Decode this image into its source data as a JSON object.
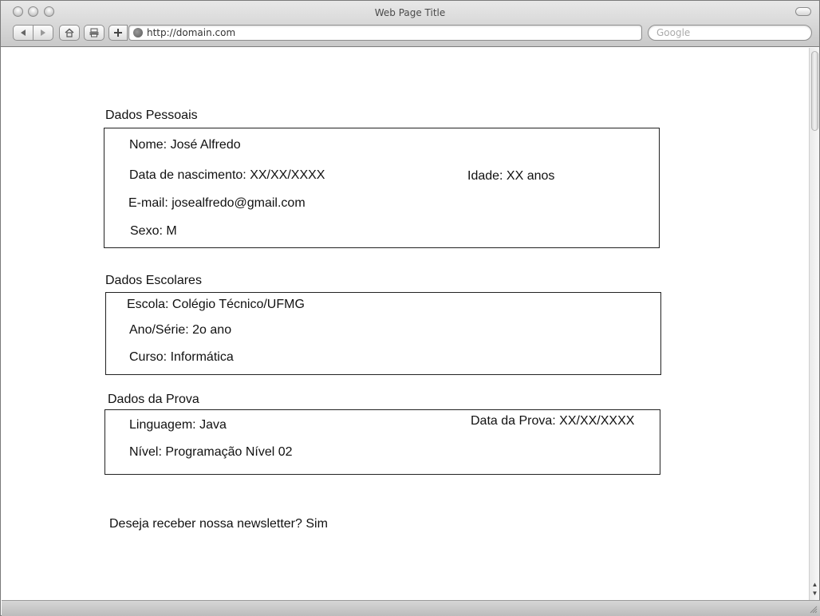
{
  "window": {
    "title": "Web Page Title",
    "url": "http://domain.com",
    "search_placeholder": "Google"
  },
  "personal": {
    "heading": "Dados Pessoais",
    "nome": "Nome: José Alfredo",
    "nascimento": "Data de nascimento: XX/XX/XXXX",
    "idade": "Idade: XX anos",
    "email": "E-mail: josealfredo@gmail.com",
    "sexo": "Sexo: M"
  },
  "school": {
    "heading": "Dados Escolares",
    "escola": "Escola: Colégio Técnico/UFMG",
    "ano": "Ano/Série: 2o ano",
    "curso": "Curso: Informática"
  },
  "exam": {
    "heading": "Dados da Prova",
    "linguagem": "Linguagem: Java",
    "data": "Data da Prova: XX/XX/XXXX",
    "nivel": "Nível: Programação Nível 02"
  },
  "newsletter": "Deseja receber nossa newsletter? Sim"
}
